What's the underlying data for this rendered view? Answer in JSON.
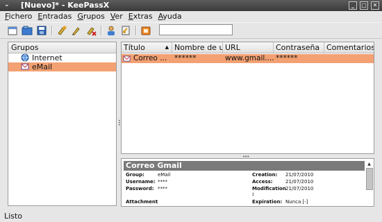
{
  "window": {
    "title": "[Nuevo]* - KeePassX",
    "menu_arrow": "⌄",
    "buttons": {
      "minimize": "_",
      "maximize": "□",
      "close": "✕"
    }
  },
  "menu": [
    {
      "u": "F",
      "rest": "ichero"
    },
    {
      "u": "E",
      "rest": "ntradas"
    },
    {
      "u": "G",
      "rest": "rupos"
    },
    {
      "u": "V",
      "rest": "er"
    },
    {
      "u": "E",
      "rest": "xtras"
    },
    {
      "u": "A",
      "rest": "yuda"
    }
  ],
  "toolbar": {
    "icons": [
      "new-database-icon",
      "open-database-icon",
      "save-database-icon",
      "add-entry-icon",
      "edit-entry-icon",
      "delete-entry-icon",
      "copy-username-icon",
      "copy-password-icon",
      "lock-workspace-icon"
    ],
    "search": {
      "value": "",
      "placeholder": ""
    }
  },
  "groups": {
    "header": "Grupos",
    "items": [
      {
        "label": "Internet",
        "icon": "globe-icon",
        "selected": false
      },
      {
        "label": "eMail",
        "icon": "envelope-icon",
        "selected": true
      }
    ]
  },
  "table": {
    "headers": [
      "Título",
      "Nombre de us",
      "URL",
      "Contraseña",
      "Comentarios"
    ],
    "sort_indicator": "▲",
    "rows": [
      {
        "icon": "envelope-icon",
        "title": "Correo ...",
        "username": "******",
        "url": "www.gmail....",
        "password": "******",
        "comment": ""
      }
    ]
  },
  "details": {
    "title": "Correo Gmail",
    "left": [
      {
        "label": "Group:",
        "value": "eMail"
      },
      {
        "label": "Username:",
        "value": "****"
      },
      {
        "label": "Password:",
        "value": "****"
      },
      {
        "label": "Attachment",
        "value": ""
      }
    ],
    "right": [
      {
        "label": "Creation:",
        "value": "21/07/2010"
      },
      {
        "label": "Access:",
        "value": "21/07/2010"
      },
      {
        "label": "Modification",
        "extra": ":",
        "value": "21/07/2010"
      },
      {
        "label": "Expiration:",
        "value": "Nunca [-]"
      }
    ]
  },
  "status": "Listo",
  "colors": {
    "selection": "#f3a173",
    "titlebar": "#4a4a4a",
    "background": "#e6e6e6"
  }
}
